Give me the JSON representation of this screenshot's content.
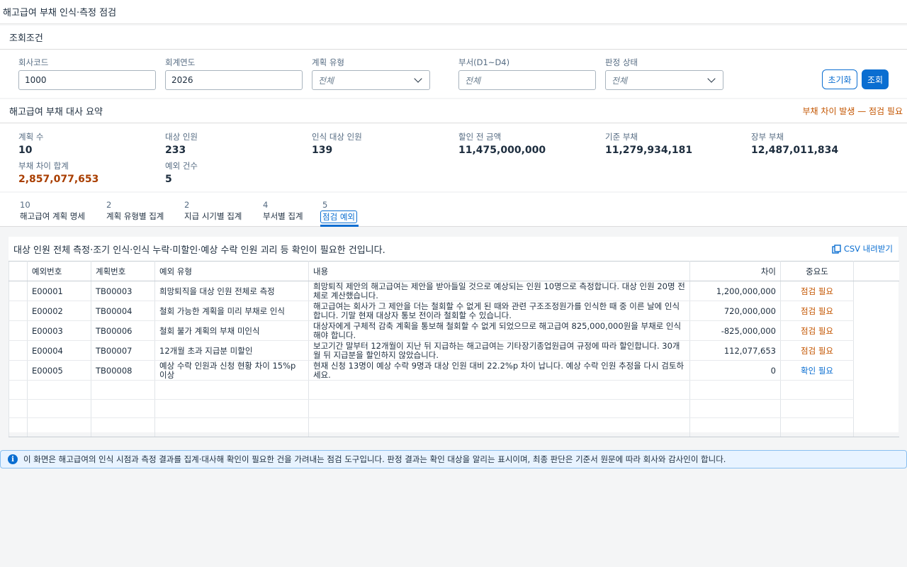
{
  "app": {
    "title": "해고급여 부채 인식·측정 점검"
  },
  "filters": {
    "section_title": "조회조건",
    "company_code": {
      "label": "회사코드",
      "value": "1000"
    },
    "fiscal_year": {
      "label": "회계연도",
      "value": "2026"
    },
    "plan_type": {
      "label": "계획 유형",
      "value": "전체"
    },
    "department": {
      "label": "부서(D1~D4)",
      "placeholder": "전체"
    },
    "judgement_status": {
      "label": "판정 상태",
      "value": "전체"
    },
    "reset_label": "초기화",
    "search_label": "조회"
  },
  "summary": {
    "title": "해고급여 부채 대사 요약",
    "warning": "부채 차이 발생 — 점검 필요",
    "kpis": [
      {
        "label": "계획 수",
        "value": "10"
      },
      {
        "label": "대상 인원",
        "value": "233"
      },
      {
        "label": "인식 대상 인원",
        "value": "139"
      },
      {
        "label": "할인 전 금액",
        "value": "11,475,000,000"
      },
      {
        "label": "기준 부채",
        "value": "11,279,934,181"
      },
      {
        "label": "장부 부채",
        "value": "12,487,011,834"
      },
      {
        "label": "부채 차이 합계",
        "value": "2,857,077,653"
      },
      {
        "label": "예외 건수",
        "value": "5"
      }
    ]
  },
  "tabs": [
    {
      "count": "10",
      "label": "해고급여 계획 명세"
    },
    {
      "count": "2",
      "label": "계획 유형별 집계"
    },
    {
      "count": "2",
      "label": "지급 시기별 집계"
    },
    {
      "count": "4",
      "label": "부서별 집계"
    },
    {
      "count": "5",
      "label": "점검 예외"
    }
  ],
  "exceptions": {
    "title": "대상 인원 전체 측정·조기 인식·인식 누락·미할인·예상 수락 인원 괴리 등 확인이 필요한 건입니다.",
    "csv_label": "CSV 내려받기",
    "columns": [
      "예외번호",
      "계획번호",
      "예외 유형",
      "내용",
      "차이",
      "중요도"
    ],
    "rows": [
      {
        "id": "E00001",
        "plan": "TB00003",
        "type": "희망퇴직을 대상 인원 전체로 측정",
        "content": "희망퇴직 제안의 해고급여는 제안을 받아들일 것으로 예상되는 인원 10명으로 측정합니다. 대상 인원 20명 전체로 계산했습니다.",
        "diff": "1,200,000,000",
        "level": "점검 필요",
        "level_kind": "warn"
      },
      {
        "id": "E00002",
        "plan": "TB00004",
        "type": "철회 가능한 계획을 미리 부채로 인식",
        "content": "해고급여는 회사가 그 제안을 더는 철회할 수 없게 된 때와 관련 구조조정원가를 인식한 때 중 이른 날에 인식합니다. 기말 현재 대상자 통보 전이라 철회할 수 있습니다.",
        "diff": "720,000,000",
        "level": "점검 필요",
        "level_kind": "warn"
      },
      {
        "id": "E00003",
        "plan": "TB00006",
        "type": "철회 불가 계획의 부채 미인식",
        "content": "대상자에게 구체적 감축 계획을 통보해 철회할 수 없게 되었으므로 해고급여 825,000,000원을 부채로 인식해야 합니다.",
        "diff": "-825,000,000",
        "level": "점검 필요",
        "level_kind": "warn"
      },
      {
        "id": "E00004",
        "plan": "TB00007",
        "type": "12개월 초과 지급분 미할인",
        "content": "보고기간 말부터 12개월이 지난 뒤 지급하는 해고급여는 기타장기종업원급여 규정에 따라 할인합니다. 30개월 뒤 지급분을 할인하지 않았습니다.",
        "diff": "112,077,653",
        "level": "점검 필요",
        "level_kind": "warn"
      },
      {
        "id": "E00005",
        "plan": "TB00008",
        "type": "예상 수락 인원과 신청 현황 차이 15%p 이상",
        "content": "현재 신청 13명이 예상 수락 9명과 대상 인원 대비 22.2%p 차이 납니다. 예상 수락 인원 추정을 다시 검토하세요.",
        "diff": "0",
        "level": "확인 필요",
        "level_kind": "info"
      }
    ]
  },
  "notice": {
    "text": "이 화면은 해고급여의 인식 시점과 측정 결과를 집계·대사해 확인이 필요한 건을 가려내는 점검 도구입니다. 판정 결과는 확인 대상을 알리는 표시이며, 최종 판단은 기준서 원문에 따라 회사와 감사인이 합니다."
  }
}
